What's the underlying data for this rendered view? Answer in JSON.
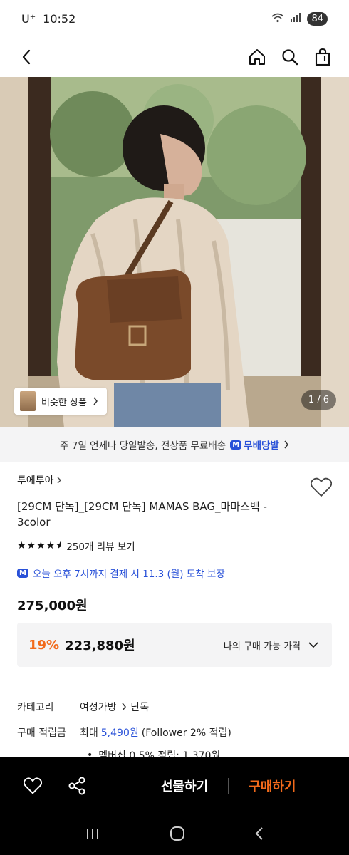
{
  "status_bar": {
    "carrier": "U⁺",
    "time": "10:52",
    "battery": "84"
  },
  "hero": {
    "similar_label": "비슷한 상품",
    "page_indicator": "1 / 6"
  },
  "shipping_banner": {
    "text": "주 7일 언제나 당일발송, 전상품 무료배송",
    "logo_text": "무배당발",
    "logo_badge": "M"
  },
  "product": {
    "brand": "투에투아",
    "name": "[29CM 단독]_[29CM 단독] MAMAS BAG_마마스백 - 3color",
    "rating_stars": 4.5,
    "review_link": "250개 리뷰 보기",
    "delivery_badge": "M",
    "delivery_text": "오늘 오후 7시까지 결제 시 11.3 (월) 도착 보장",
    "original_price": "275,000원",
    "discount_rate": "19%",
    "sale_price": "223,880원",
    "my_price_label": "나의 구매 가능 가격"
  },
  "details": {
    "category_key": "카테고리",
    "category_path": [
      "여성가방",
      "단독"
    ],
    "points_key": "구매 적립금",
    "points_prefix": "최대",
    "points_value": "5,490원",
    "points_suffix": "(Follower 2% 적립)",
    "membership_point": "멤버십 0.5% 적립: 1,370원"
  },
  "action_bar": {
    "gift_label": "선물하기",
    "buy_label": "구매하기"
  },
  "colors": {
    "accent_orange": "#f26a1b",
    "brand_blue": "#2951d8",
    "bar_black": "#000000"
  }
}
